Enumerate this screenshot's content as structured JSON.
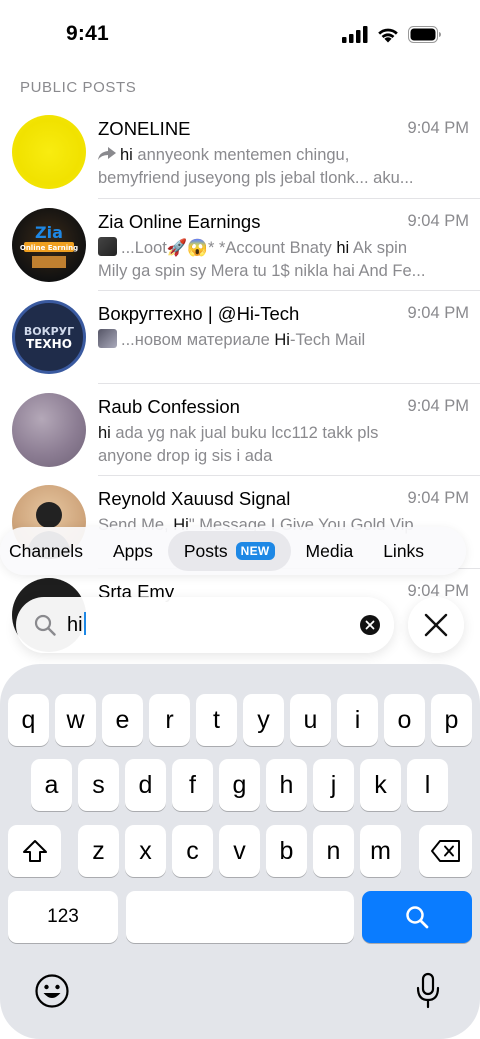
{
  "status_bar": {
    "time": "9:41"
  },
  "section_label": "PUBLIC POSTS",
  "results": [
    {
      "title": "ZONELINE",
      "time": "9:04 PM",
      "prefix": "",
      "highlight": "hi",
      "line1_rest": " annyeonk mentemen chingu,",
      "line2": "bemyfriend juseyong pls jebal tlonk... aku...",
      "avatar_color": "#f2e600"
    },
    {
      "title": "Zia Online Earnings",
      "time": "9:04 PM",
      "prefix": "...Loot🚀😱* *Account Bnaty ",
      "highlight": "hi",
      "line1_rest": " Ak spin",
      "line2": "Mily ga spin sy Mera tu 1$ nikla hai And Fe...",
      "avatar_color": "#1a1a1a"
    },
    {
      "title": "Вокругтехно | @Hi-Tech",
      "time": "9:04 PM",
      "prefix": "...новом материале ",
      "highlight": "Hi",
      "line1_rest": "-Tech Mail",
      "line2": "",
      "avatar_color": "#1d2a44"
    },
    {
      "title": "Raub Confession",
      "time": "9:04 PM",
      "prefix": "",
      "highlight": "hi",
      "line1_rest": " ada yg nak jual buku lcc112 takk pls",
      "line2": "anyone drop ig sis i ada",
      "avatar_color": "#8e7f95"
    },
    {
      "title": "Reynold Xauusd Signal",
      "time": "9:04 PM",
      "prefix": "Send Me, ",
      "highlight": "Hi",
      "line1_rest": "\" Message I Give You Gold Vip",
      "line2": "",
      "avatar_color": "#d9b48f"
    },
    {
      "title": "Srta Emy",
      "time": "9:04 PM",
      "prefix": "",
      "highlight": "",
      "line1_rest": "",
      "line2": "",
      "avatar_color": "#222222"
    }
  ],
  "tabs": [
    {
      "label": "Channels",
      "active": false
    },
    {
      "label": "Apps",
      "active": false
    },
    {
      "label": "Posts",
      "active": true,
      "badge": "NEW"
    },
    {
      "label": "Media",
      "active": false
    },
    {
      "label": "Links",
      "active": false
    }
  ],
  "search": {
    "query": "hi"
  },
  "keyboard": {
    "row1": [
      "q",
      "w",
      "e",
      "r",
      "t",
      "y",
      "u",
      "i",
      "o",
      "p"
    ],
    "row2": [
      "a",
      "s",
      "d",
      "f",
      "g",
      "h",
      "j",
      "k",
      "l"
    ],
    "row3": [
      "z",
      "x",
      "c",
      "v",
      "b",
      "n",
      "m"
    ],
    "numbers_key": "123"
  }
}
